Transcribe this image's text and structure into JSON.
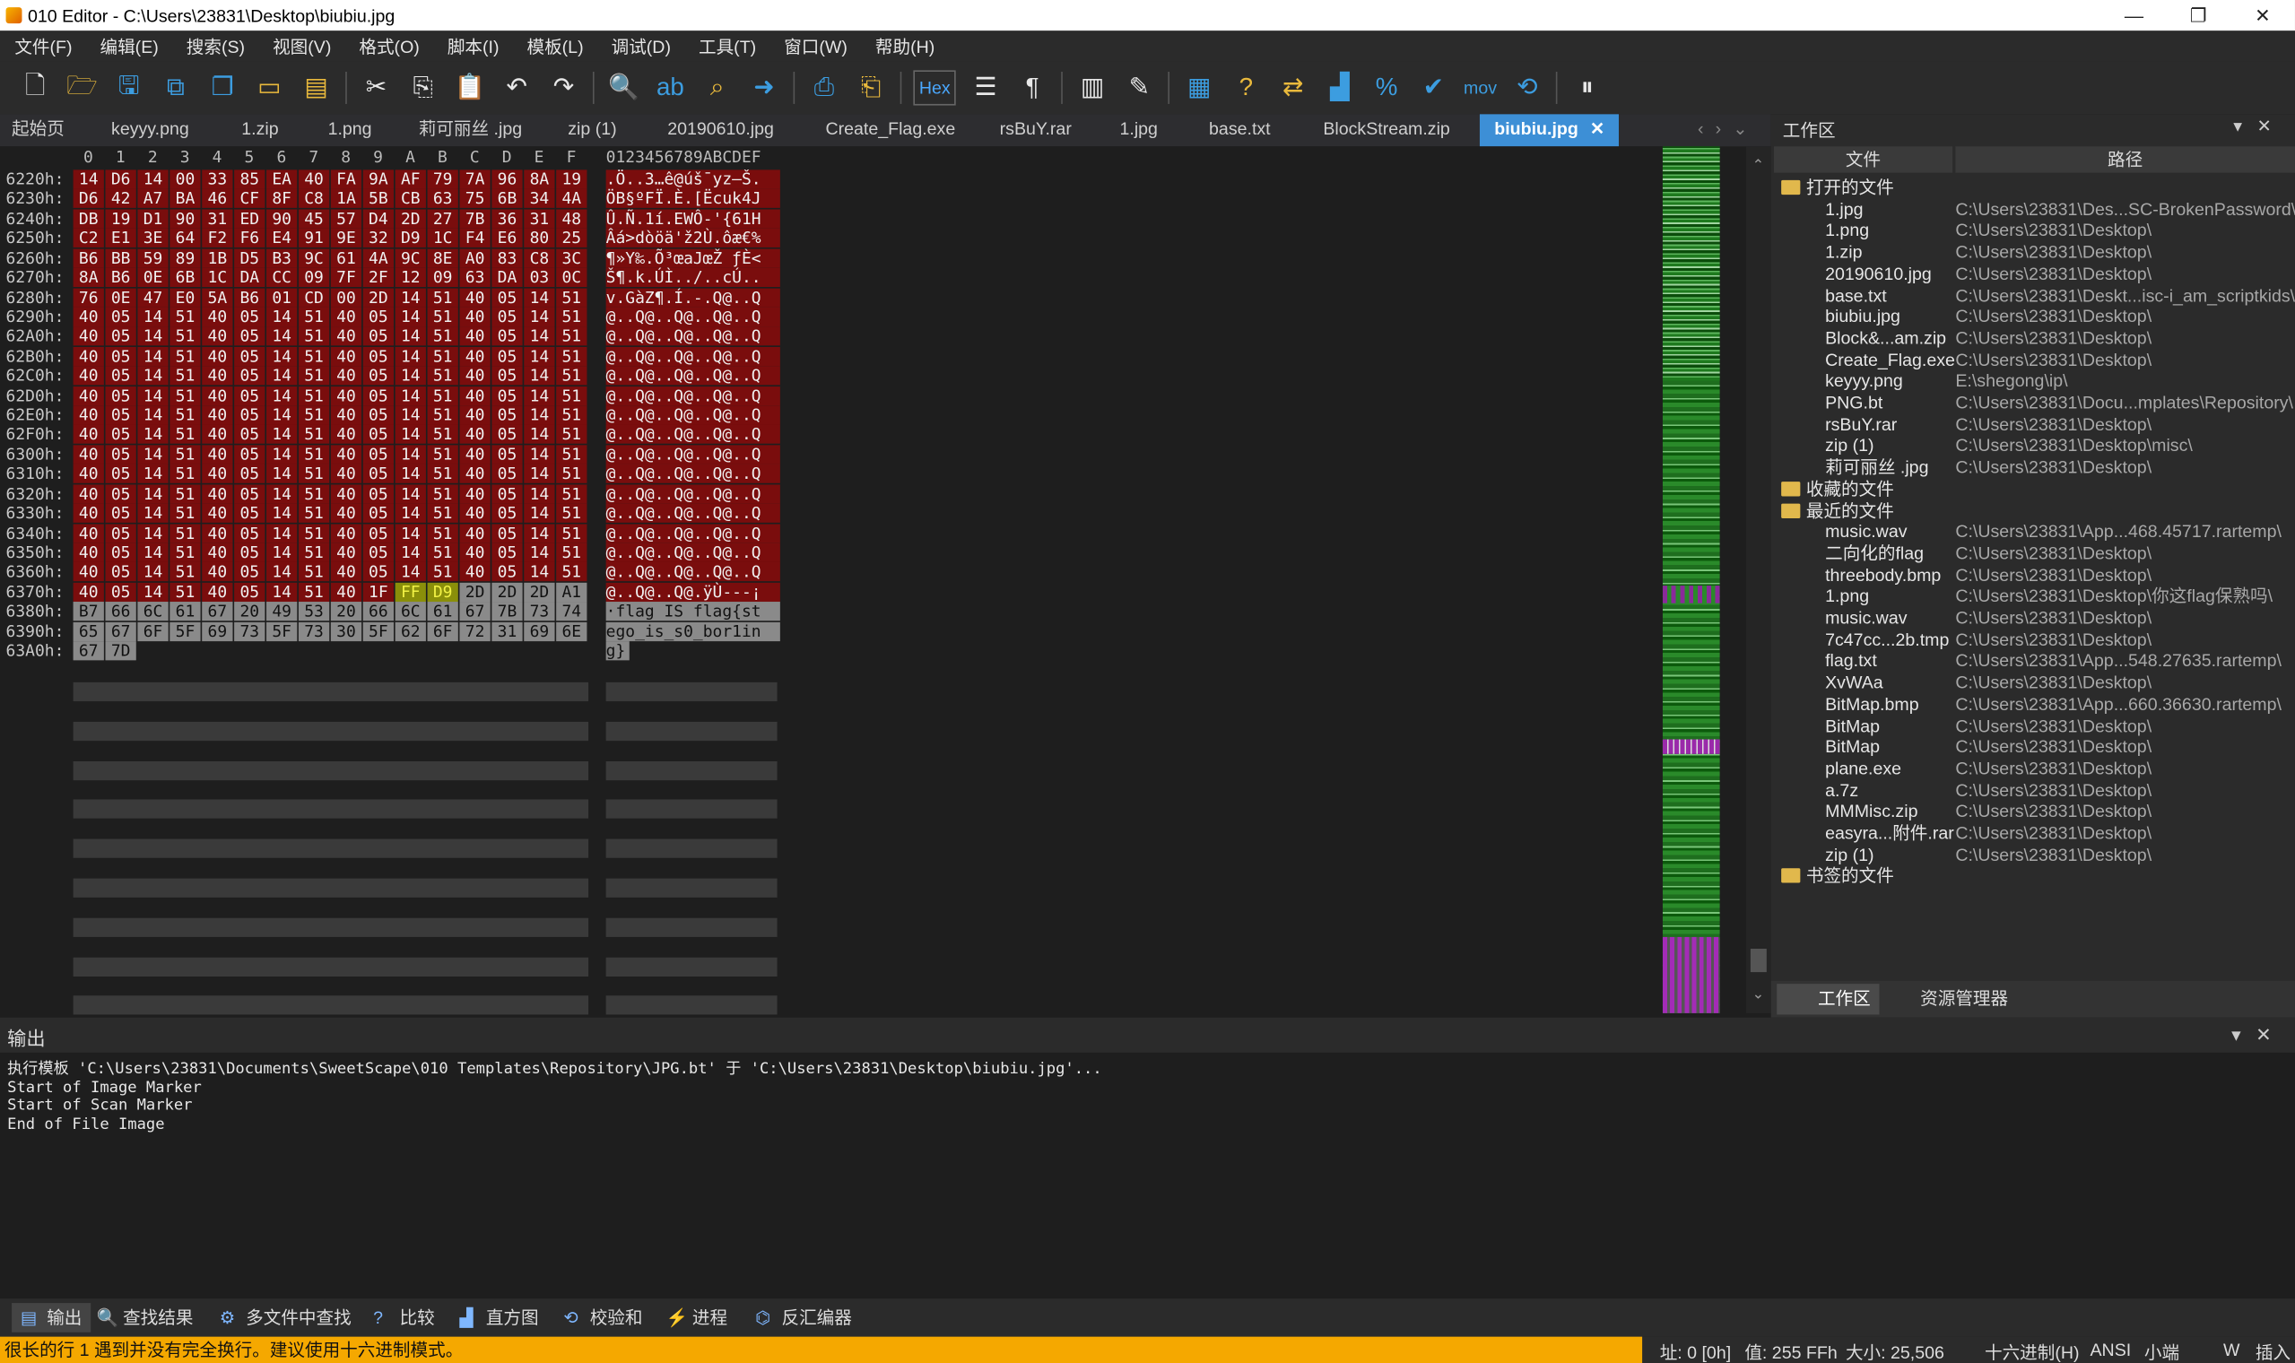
{
  "window": {
    "title": "010 Editor - C:\\Users\\23831\\Desktop\\biubiu.jpg",
    "min": "—",
    "max": "❐",
    "close": "✕"
  },
  "menu": [
    "文件(F)",
    "编辑(E)",
    "搜索(S)",
    "视图(V)",
    "格式(O)",
    "脚本(I)",
    "模板(L)",
    "调试(D)",
    "工具(T)",
    "窗口(W)",
    "帮助(H)"
  ],
  "toolbar": {
    "hex_label": "Hex",
    "mov_label": "mov"
  },
  "tabs": [
    "起始页",
    "keyyy.png",
    "1.zip",
    "1.png",
    "莉可丽丝 .jpg",
    "zip (1)",
    "20190610.jpg",
    "Create_Flag.exe",
    "rsBuY.rar",
    "1.jpg",
    "base.txt",
    "BlockStream.zip",
    "biubiu.jpg"
  ],
  "active_tab_close": "✕",
  "hex": {
    "col_header": [
      "0",
      "1",
      "2",
      "3",
      "4",
      "5",
      "6",
      "7",
      "8",
      "9",
      "A",
      "B",
      "C",
      "D",
      "E",
      "F"
    ],
    "ascii_header": "0123456789ABCDEF",
    "rows": [
      {
        "addr": "6220h:",
        "bytes": [
          "14",
          "D6",
          "14",
          "00",
          "33",
          "85",
          "EA",
          "40",
          "FA",
          "9A",
          "AF",
          "79",
          "7A",
          "96",
          "8A",
          "19"
        ],
        "ascii": ".Ö..3…ê@úš¯yz–Š."
      },
      {
        "addr": "6230h:",
        "bytes": [
          "D6",
          "42",
          "A7",
          "BA",
          "46",
          "CF",
          "8F",
          "C8",
          "1A",
          "5B",
          "CB",
          "63",
          "75",
          "6B",
          "34",
          "4A"
        ],
        "ascii": "ÖB§ºFÏ.È.[Ëcuk4J"
      },
      {
        "addr": "6240h:",
        "bytes": [
          "DB",
          "19",
          "D1",
          "90",
          "31",
          "ED",
          "90",
          "45",
          "57",
          "D4",
          "2D",
          "27",
          "7B",
          "36",
          "31",
          "48"
        ],
        "ascii": "Û.Ñ.1í.EWÔ-'{61H"
      },
      {
        "addr": "6250h:",
        "bytes": [
          "C2",
          "E1",
          "3E",
          "64",
          "F2",
          "F6",
          "E4",
          "91",
          "9E",
          "32",
          "D9",
          "1C",
          "F4",
          "E6",
          "80",
          "25"
        ],
        "ascii": "Âá>dòöä'ž2Ù.ôæ€%"
      },
      {
        "addr": "6260h:",
        "bytes": [
          "B6",
          "BB",
          "59",
          "89",
          "1B",
          "D5",
          "B3",
          "9C",
          "61",
          "4A",
          "9C",
          "8E",
          "A0",
          "83",
          "C8",
          "3C"
        ],
        "ascii": "¶»Y‰.Õ³œaJœŽ ƒÈ<"
      },
      {
        "addr": "6270h:",
        "bytes": [
          "8A",
          "B6",
          "0E",
          "6B",
          "1C",
          "DA",
          "CC",
          "09",
          "7F",
          "2F",
          "12",
          "09",
          "63",
          "DA",
          "03",
          "0C"
        ],
        "ascii": "Š¶.k.ÚÌ../..cÚ.."
      },
      {
        "addr": "6280h:",
        "bytes": [
          "76",
          "0E",
          "47",
          "E0",
          "5A",
          "B6",
          "01",
          "CD",
          "00",
          "2D",
          "14",
          "51",
          "40",
          "05",
          "14",
          "51"
        ],
        "ascii": "v.GàZ¶.Í.-.Q@..Q"
      },
      {
        "addr": "6290h:",
        "bytes": [
          "40",
          "05",
          "14",
          "51",
          "40",
          "05",
          "14",
          "51",
          "40",
          "05",
          "14",
          "51",
          "40",
          "05",
          "14",
          "51"
        ],
        "ascii": "@..Q@..Q@..Q@..Q"
      },
      {
        "addr": "62A0h:",
        "bytes": [
          "40",
          "05",
          "14",
          "51",
          "40",
          "05",
          "14",
          "51",
          "40",
          "05",
          "14",
          "51",
          "40",
          "05",
          "14",
          "51"
        ],
        "ascii": "@..Q@..Q@..Q@..Q"
      },
      {
        "addr": "62B0h:",
        "bytes": [
          "40",
          "05",
          "14",
          "51",
          "40",
          "05",
          "14",
          "51",
          "40",
          "05",
          "14",
          "51",
          "40",
          "05",
          "14",
          "51"
        ],
        "ascii": "@..Q@..Q@..Q@..Q"
      },
      {
        "addr": "62C0h:",
        "bytes": [
          "40",
          "05",
          "14",
          "51",
          "40",
          "05",
          "14",
          "51",
          "40",
          "05",
          "14",
          "51",
          "40",
          "05",
          "14",
          "51"
        ],
        "ascii": "@..Q@..Q@..Q@..Q"
      },
      {
        "addr": "62D0h:",
        "bytes": [
          "40",
          "05",
          "14",
          "51",
          "40",
          "05",
          "14",
          "51",
          "40",
          "05",
          "14",
          "51",
          "40",
          "05",
          "14",
          "51"
        ],
        "ascii": "@..Q@..Q@..Q@..Q"
      },
      {
        "addr": "62E0h:",
        "bytes": [
          "40",
          "05",
          "14",
          "51",
          "40",
          "05",
          "14",
          "51",
          "40",
          "05",
          "14",
          "51",
          "40",
          "05",
          "14",
          "51"
        ],
        "ascii": "@..Q@..Q@..Q@..Q"
      },
      {
        "addr": "62F0h:",
        "bytes": [
          "40",
          "05",
          "14",
          "51",
          "40",
          "05",
          "14",
          "51",
          "40",
          "05",
          "14",
          "51",
          "40",
          "05",
          "14",
          "51"
        ],
        "ascii": "@..Q@..Q@..Q@..Q"
      },
      {
        "addr": "6300h:",
        "bytes": [
          "40",
          "05",
          "14",
          "51",
          "40",
          "05",
          "14",
          "51",
          "40",
          "05",
          "14",
          "51",
          "40",
          "05",
          "14",
          "51"
        ],
        "ascii": "@..Q@..Q@..Q@..Q"
      },
      {
        "addr": "6310h:",
        "bytes": [
          "40",
          "05",
          "14",
          "51",
          "40",
          "05",
          "14",
          "51",
          "40",
          "05",
          "14",
          "51",
          "40",
          "05",
          "14",
          "51"
        ],
        "ascii": "@..Q@..Q@..Q@..Q"
      },
      {
        "addr": "6320h:",
        "bytes": [
          "40",
          "05",
          "14",
          "51",
          "40",
          "05",
          "14",
          "51",
          "40",
          "05",
          "14",
          "51",
          "40",
          "05",
          "14",
          "51"
        ],
        "ascii": "@..Q@..Q@..Q@..Q"
      },
      {
        "addr": "6330h:",
        "bytes": [
          "40",
          "05",
          "14",
          "51",
          "40",
          "05",
          "14",
          "51",
          "40",
          "05",
          "14",
          "51",
          "40",
          "05",
          "14",
          "51"
        ],
        "ascii": "@..Q@..Q@..Q@..Q"
      },
      {
        "addr": "6340h:",
        "bytes": [
          "40",
          "05",
          "14",
          "51",
          "40",
          "05",
          "14",
          "51",
          "40",
          "05",
          "14",
          "51",
          "40",
          "05",
          "14",
          "51"
        ],
        "ascii": "@..Q@..Q@..Q@..Q"
      },
      {
        "addr": "6350h:",
        "bytes": [
          "40",
          "05",
          "14",
          "51",
          "40",
          "05",
          "14",
          "51",
          "40",
          "05",
          "14",
          "51",
          "40",
          "05",
          "14",
          "51"
        ],
        "ascii": "@..Q@..Q@..Q@..Q"
      },
      {
        "addr": "6360h:",
        "bytes": [
          "40",
          "05",
          "14",
          "51",
          "40",
          "05",
          "14",
          "51",
          "40",
          "05",
          "14",
          "51",
          "40",
          "05",
          "14",
          "51"
        ],
        "ascii": "@..Q@..Q@..Q@..Q"
      },
      {
        "addr": "6370h:",
        "bytes": [
          "40",
          "05",
          "14",
          "51",
          "40",
          "05",
          "14",
          "51",
          "40",
          "1F",
          "FF",
          "D9",
          "2D",
          "2D",
          "2D",
          "A1"
        ],
        "ascii": "@..Q@..Q@.ÿÙ---¡"
      },
      {
        "addr": "6380h:",
        "bytes": [
          "B7",
          "66",
          "6C",
          "61",
          "67",
          "20",
          "49",
          "53",
          "20",
          "66",
          "6C",
          "61",
          "67",
          "7B",
          "73",
          "74"
        ],
        "ascii": "·flag IS flag{st"
      },
      {
        "addr": "6390h:",
        "bytes": [
          "65",
          "67",
          "6F",
          "5F",
          "69",
          "73",
          "5F",
          "73",
          "30",
          "5F",
          "62",
          "6F",
          "72",
          "31",
          "69",
          "6E"
        ],
        "ascii": "ego_is_s0_bor1in"
      },
      {
        "addr": "63A0h:",
        "bytes": [
          "67",
          "7D"
        ],
        "ascii": "g}"
      }
    ]
  },
  "workspace": {
    "title": "工作区",
    "col_file": "文件",
    "col_path": "路径",
    "groups": {
      "open": "打开的文件",
      "fav": "收藏的文件",
      "recent": "最近的文件",
      "bookmark": "书签的文件"
    },
    "open_files": [
      {
        "name": "1.jpg",
        "path": "C:\\Users\\23831\\Des...SC-BrokenPassword\\"
      },
      {
        "name": "1.png",
        "path": "C:\\Users\\23831\\Desktop\\"
      },
      {
        "name": "1.zip",
        "path": "C:\\Users\\23831\\Desktop\\"
      },
      {
        "name": "20190610.jpg",
        "path": "C:\\Users\\23831\\Desktop\\"
      },
      {
        "name": "base.txt",
        "path": "C:\\Users\\23831\\Deskt...isc-i_am_scriptkids\\"
      },
      {
        "name": "biubiu.jpg",
        "path": "C:\\Users\\23831\\Desktop\\"
      },
      {
        "name": "Block&...am.zip",
        "path": "C:\\Users\\23831\\Desktop\\"
      },
      {
        "name": "Create_Flag.exe",
        "path": "C:\\Users\\23831\\Desktop\\"
      },
      {
        "name": "keyyy.png",
        "path": "E:\\shegong\\ip\\"
      },
      {
        "name": "PNG.bt",
        "path": "C:\\Users\\23831\\Docu...mplates\\Repository\\"
      },
      {
        "name": "rsBuY.rar",
        "path": "C:\\Users\\23831\\Desktop\\"
      },
      {
        "name": "zip (1)",
        "path": "C:\\Users\\23831\\Desktop\\misc\\"
      },
      {
        "name": "莉可丽丝 .jpg",
        "path": "C:\\Users\\23831\\Desktop\\"
      }
    ],
    "recent_files": [
      {
        "name": "music.wav",
        "path": "C:\\Users\\23831\\App...468.45717.rartemp\\"
      },
      {
        "name": "二向化的flag",
        "path": "C:\\Users\\23831\\Desktop\\"
      },
      {
        "name": "threebody.bmp",
        "path": "C:\\Users\\23831\\Desktop\\"
      },
      {
        "name": "1.png",
        "path": "C:\\Users\\23831\\Desktop\\你这flag保熟吗\\"
      },
      {
        "name": "music.wav",
        "path": "C:\\Users\\23831\\Desktop\\"
      },
      {
        "name": "7c47cc...2b.tmp",
        "path": "C:\\Users\\23831\\Desktop\\"
      },
      {
        "name": "flag.txt",
        "path": "C:\\Users\\23831\\App...548.27635.rartemp\\"
      },
      {
        "name": "XvWAa",
        "path": "C:\\Users\\23831\\Desktop\\"
      },
      {
        "name": "BitMap.bmp",
        "path": "C:\\Users\\23831\\App...660.36630.rartemp\\"
      },
      {
        "name": "BitMap",
        "path": "C:\\Users\\23831\\Desktop\\"
      },
      {
        "name": "BitMap",
        "path": "C:\\Users\\23831\\Desktop\\"
      },
      {
        "name": "plane.exe",
        "path": "C:\\Users\\23831\\Desktop\\"
      },
      {
        "name": "a.7z",
        "path": "C:\\Users\\23831\\Desktop\\"
      },
      {
        "name": "MMMisc.zip",
        "path": "C:\\Users\\23831\\Desktop\\"
      },
      {
        "name": "easyra...附件.rar",
        "path": "C:\\Users\\23831\\Desktop\\"
      },
      {
        "name": "zip (1)",
        "path": "C:\\Users\\23831\\Desktop\\"
      }
    ],
    "tab_workspace": "工作区",
    "tab_explorer": "资源管理器"
  },
  "output": {
    "title": "输出",
    "lines": [
      "执行模板 'C:\\Users\\23831\\Documents\\SweetScape\\010 Templates\\Repository\\JPG.bt' 于 'C:\\Users\\23831\\Desktop\\biubiu.jpg'...",
      "Start of Image Marker",
      "Start of Scan Marker",
      "End of File Image"
    ]
  },
  "bottom_tabs": [
    "输出",
    "查找结果",
    "多文件中查找",
    "比较",
    "直方图",
    "校验和",
    "进程",
    "反汇编器"
  ],
  "status": {
    "message": "很长的行 1 遇到并没有完全换行。建议使用十六进制模式。",
    "addr": "址: 0 [0h]",
    "value": "值: 255 FFh",
    "size": "大小: 25,506",
    "mode": "十六进制(H)",
    "encoding": "ANSI",
    "endian": "小端",
    "w": "W",
    "insert": "插入"
  }
}
